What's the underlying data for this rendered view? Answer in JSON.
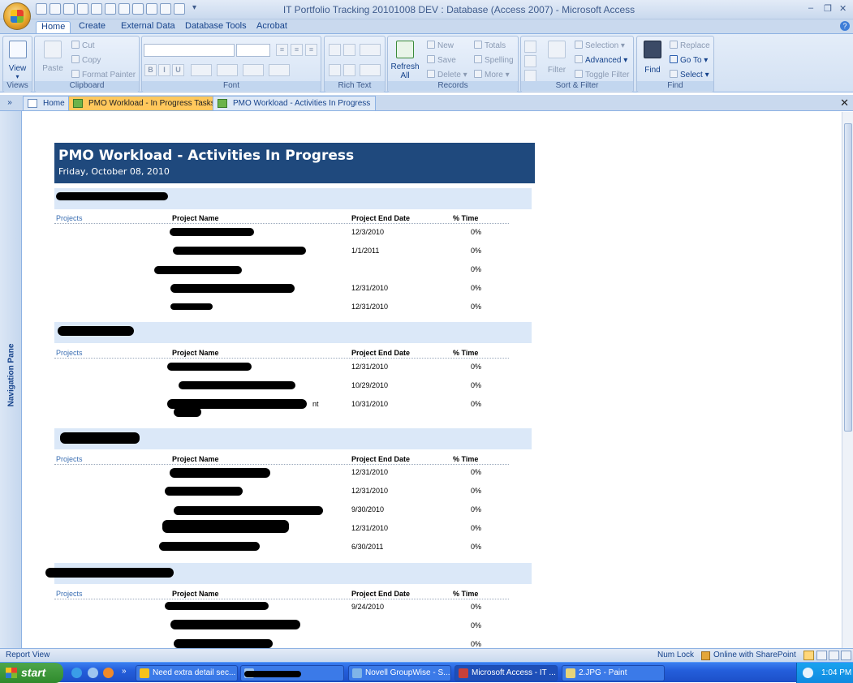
{
  "window": {
    "title": "IT Portfolio Tracking 20101008 DEV : Database (Access 2007) - Microsoft Access",
    "minimize": "–",
    "restore": "❐",
    "close": "✕",
    "qat_more": "▾"
  },
  "ribbon_tabs": [
    "Home",
    "Create",
    "External Data",
    "Database Tools",
    "Acrobat"
  ],
  "ribbon": {
    "views": {
      "label": "Views",
      "view": "View"
    },
    "clipboard": {
      "label": "Clipboard",
      "paste": "Paste",
      "cut": "Cut",
      "copy": "Copy",
      "format_painter": "Format Painter"
    },
    "font": {
      "label": "Font",
      "bold": "B",
      "italic": "I",
      "underline": "U"
    },
    "rich_text": {
      "label": "Rich Text"
    },
    "records": {
      "label": "Records",
      "refresh": "Refresh All",
      "new": "New",
      "save": "Save",
      "delete": "Delete",
      "totals": "Totals",
      "spelling": "Spelling",
      "more": "More"
    },
    "sort_filter": {
      "label": "Sort & Filter",
      "filter": "Filter",
      "selection": "Selection",
      "advanced": "Advanced",
      "toggle_filter": "Toggle Filter"
    },
    "find": {
      "label": "Find",
      "find": "Find",
      "replace": "Replace",
      "goto": "Go To",
      "select": "Select"
    }
  },
  "doc_tabs": [
    "Home",
    "PMO Workload - In Progress Tasks",
    "PMO Workload - Activities In Progress"
  ],
  "doc_nav_toggle": "»",
  "doc_close": "✕",
  "nav_pane": "Navigation Pane",
  "report": {
    "title": "PMO Workload - Activities In Progress",
    "date": "Friday, October 08, 2010",
    "col_projects": "Projects",
    "col_name": "Project Name",
    "col_end": "Project End Date",
    "col_time": "% Time",
    "groups": [
      {
        "rows": [
          {
            "end": "12/3/2010",
            "time": "0%"
          },
          {
            "end": "1/1/2011",
            "time": "0%"
          },
          {
            "end": "",
            "time": "0%"
          },
          {
            "end": "12/31/2010",
            "time": "0%"
          },
          {
            "end": "12/31/2010",
            "time": "0%"
          }
        ]
      },
      {
        "rows": [
          {
            "end": "12/31/2010",
            "time": "0%"
          },
          {
            "end": "10/29/2010",
            "time": "0%"
          },
          {
            "end": "10/31/2010",
            "time": "0%"
          }
        ],
        "visible_fragments": [
          "nt"
        ]
      },
      {
        "rows": [
          {
            "end": "12/31/2010",
            "time": "0%"
          },
          {
            "end": "12/31/2010",
            "time": "0%"
          },
          {
            "end": "9/30/2010",
            "time": "0%"
          },
          {
            "end": "12/31/2010",
            "time": "0%"
          },
          {
            "end": "6/30/2011",
            "time": "0%"
          }
        ]
      },
      {
        "rows": [
          {
            "end": "9/24/2010",
            "time": "0%"
          },
          {
            "end": "",
            "time": "0%"
          },
          {
            "end": "",
            "time": "0%"
          }
        ]
      }
    ]
  },
  "status": {
    "left": "Report View",
    "num_lock": "Num Lock",
    "sharepoint": "Online with SharePoint"
  },
  "taskbar": {
    "start": "start",
    "items": [
      "Need extra detail sec...",
      "Novell GroupWise - S...",
      "Microsoft Access - IT ...",
      "2.JPG - Paint"
    ],
    "chevron": "»",
    "time": "1:04 PM"
  }
}
